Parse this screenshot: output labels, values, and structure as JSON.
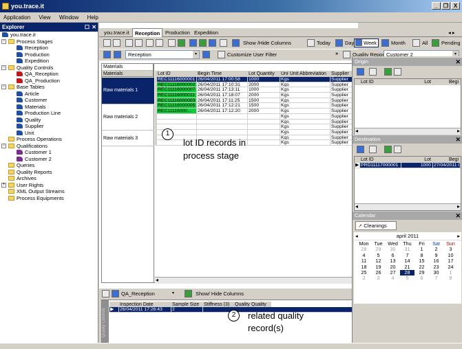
{
  "window": {
    "title": "you.trace.it",
    "controls": [
      "_",
      "❒",
      "X"
    ]
  },
  "menu": [
    {
      "label": "Application"
    },
    {
      "label": "View"
    },
    {
      "label": "Window"
    },
    {
      "label": "Help"
    }
  ],
  "explorer": {
    "title": "Explorer",
    "root": "you.trace.it",
    "items": [
      {
        "label": "Process Stages",
        "level": 0,
        "expander": "−",
        "icon": "folder"
      },
      {
        "label": "Reception",
        "level": 1,
        "icon": "leaf-blue"
      },
      {
        "label": "Production",
        "level": 1,
        "icon": "leaf-blue"
      },
      {
        "label": "Expedition",
        "level": 1,
        "icon": "leaf-blue"
      },
      {
        "label": "Quality Controls",
        "level": 0,
        "expander": "−",
        "icon": "folder"
      },
      {
        "label": "QA_Reception",
        "level": 1,
        "icon": "leaf-red"
      },
      {
        "label": "QA_Production",
        "level": 1,
        "icon": "leaf-red"
      },
      {
        "label": "Base Tables",
        "level": 0,
        "expander": "−",
        "icon": "folder"
      },
      {
        "label": "Article",
        "level": 1,
        "icon": "leaf-blue"
      },
      {
        "label": "Customer",
        "level": 1,
        "icon": "leaf-blue"
      },
      {
        "label": "Materials",
        "level": 1,
        "icon": "leaf-blue"
      },
      {
        "label": "Production Line",
        "level": 1,
        "icon": "leaf-blue"
      },
      {
        "label": "Quality",
        "level": 1,
        "icon": "leaf-blue"
      },
      {
        "label": "Supplier",
        "level": 1,
        "icon": "leaf-blue"
      },
      {
        "label": "Unit",
        "level": 1,
        "icon": "leaf-blue"
      },
      {
        "label": "Process Operations",
        "level": 0,
        "icon": "folder"
      },
      {
        "label": "Qualifications",
        "level": 0,
        "expander": "−",
        "icon": "folder"
      },
      {
        "label": "Customer 1",
        "level": 1,
        "icon": "leaf-purple"
      },
      {
        "label": "Customer 2",
        "level": 1,
        "icon": "leaf-purple"
      },
      {
        "label": "Queries",
        "level": 0,
        "icon": "folder"
      },
      {
        "label": "Quality Reports",
        "level": 0,
        "icon": "folder"
      },
      {
        "label": "Archives",
        "level": 0,
        "icon": "folder"
      },
      {
        "label": "User Rights",
        "level": 0,
        "expander": "+",
        "icon": "folder"
      },
      {
        "label": "XML Output Streams",
        "level": 0,
        "icon": "folder"
      },
      {
        "label": "Process Equipments",
        "level": 0,
        "icon": "folder"
      }
    ]
  },
  "tabs": [
    {
      "label": "you.trace.it",
      "active": false
    },
    {
      "label": "Reception",
      "active": true
    },
    {
      "label": "Production",
      "active": false
    },
    {
      "label": "Expedition",
      "active": false
    }
  ],
  "toolbar": {
    "show_hide_columns": "Show /Hide Columns",
    "today": "Today",
    "day": "Day",
    "week": "Week",
    "month": "Month",
    "all": "All",
    "pending": "Pending",
    "stage_select": "Reception",
    "customize_filter": "Customize User Filter",
    "quality_reports": "Quality Reports",
    "customer_select": "Customer 2",
    "more": "»"
  },
  "grid": {
    "materials_header": "Materials",
    "materials_column": "Materials",
    "columns": [
      "Lot ID",
      "Begin Time",
      "Lot Quantity",
      "Unit",
      "Unit Abbreviation",
      "Supplier"
    ],
    "groups": [
      {
        "label": "Raw materials 1",
        "selected": true
      },
      {
        "label": "Raw materials 2",
        "selected": false
      },
      {
        "label": "Raw materials 3",
        "selected": false
      }
    ],
    "rows": [
      {
        "lot": "REC11116000001",
        "time": "26/04/2011 17:00:58",
        "qty": "1000",
        "unit": "Kgs",
        "supplier": "Supplier",
        "selected": true,
        "green": false
      },
      {
        "lot": "REC11116000002",
        "time": "26/04/2011 17:10:31",
        "qty": "2000",
        "unit": "Kgs",
        "supplier": "Supplier",
        "selected": false,
        "green": true
      },
      {
        "lot": "REC11116000007",
        "time": "26/04/2011 17:13:11",
        "qty": "1000",
        "unit": "Kgs",
        "supplier": "Supplier",
        "selected": false,
        "green": true
      },
      {
        "lot": "REC11116000011",
        "time": "26/04/2011 17:18:07",
        "qty": "2000",
        "unit": "Kgs",
        "supplier": "Supplier",
        "selected": false,
        "green": true
      },
      {
        "lot": "REC11116000003",
        "time": "26/04/2011 17:11:25",
        "qty": "1500",
        "unit": "Kgs",
        "supplier": "Supplier",
        "selected": false,
        "green": true
      },
      {
        "lot": "REC11116000005",
        "time": "26/04/2011 17:12:21",
        "qty": "1500",
        "unit": "Kgs",
        "supplier": "Supplier",
        "selected": false,
        "green": true
      },
      {
        "lot": "REC11116000...",
        "time": "26/04/2011 17:12:20",
        "qty": "2000",
        "unit": "Kgs",
        "supplier": "Supplier",
        "selected": false,
        "green": true
      },
      {
        "lot": "",
        "time": "",
        "qty": "",
        "unit": "Kgs",
        "supplier": "Supplier",
        "selected": false,
        "green": false
      },
      {
        "lot": "",
        "time": "",
        "qty": "",
        "unit": "Kgs",
        "supplier": "Supplier",
        "selected": false,
        "green": false
      },
      {
        "lot": "",
        "time": "",
        "qty": "",
        "unit": "Kgs",
        "supplier": "Supplier",
        "selected": false,
        "green": false
      },
      {
        "lot": "",
        "time": "",
        "qty": "",
        "unit": "Kgs",
        "supplier": "Supplier",
        "selected": false,
        "green": false
      },
      {
        "lot": "",
        "time": "",
        "qty": "",
        "unit": "Kgs",
        "supplier": "Supplier",
        "selected": false,
        "green": false
      },
      {
        "lot": "",
        "time": "",
        "qty": "",
        "unit": "Kgs",
        "supplier": "Supplier",
        "selected": false,
        "green": false
      }
    ]
  },
  "annotations": [
    {
      "number": "1",
      "text_line1": "lot ID records in",
      "text_line2": "process stage"
    },
    {
      "number": "2",
      "text_line1": "related quality",
      "text_line2": "record(s)"
    }
  ],
  "quality": {
    "form_select": "QA_Reception",
    "show_hide_columns": "Show/ Hide Columns",
    "side_label": "Quality Controls",
    "columns": [
      "Inspection Date",
      "Sample Size",
      "Stiffness (3)",
      "Quality",
      "Quality"
    ],
    "rows": [
      {
        "date": "26/04/2011 17:26:43",
        "sample": "2"
      }
    ]
  },
  "origin": {
    "title": "Origin",
    "columns": [
      "Lot ID",
      "Lot",
      "Begi"
    ]
  },
  "destination": {
    "title": "Destination",
    "columns": [
      "Lot ID",
      "Lot",
      "Begi"
    ],
    "rows": [
      {
        "lot": "PRD11117000001",
        "qty": "1000",
        "time": "27/04/2011 08"
      }
    ]
  },
  "calendar": {
    "title": "Calendar",
    "tab": "Cleanings",
    "month": "april 2011",
    "weekdays": [
      "Mon",
      "Tue",
      "Wed",
      "Thu",
      "Fri",
      "Sat",
      "Sun"
    ],
    "weeks": [
      [
        "28",
        "29",
        "30",
        "31",
        "1",
        "2",
        "3"
      ],
      [
        "4",
        "5",
        "6",
        "7",
        "8",
        "9",
        "10"
      ],
      [
        "11",
        "12",
        "13",
        "14",
        "15",
        "16",
        "17"
      ],
      [
        "18",
        "19",
        "20",
        "21",
        "22",
        "23",
        "24"
      ],
      [
        "25",
        "26",
        "27",
        "28",
        "29",
        "30",
        "1"
      ],
      [
        "2",
        "3",
        "4",
        "5",
        "6",
        "7",
        "8"
      ]
    ],
    "selected_day": "28"
  },
  "colors": {
    "title_blue": "#0a246a",
    "selection": "#0a246a",
    "lot_green": "#11cc3a",
    "folder": "#f3d36b"
  }
}
